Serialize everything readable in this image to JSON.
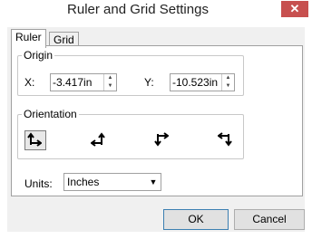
{
  "window": {
    "title": "Ruler and Grid Settings",
    "close_glyph": "✕"
  },
  "tabs": [
    {
      "label": "Ruler",
      "active": true
    },
    {
      "label": "Grid",
      "active": false
    }
  ],
  "origin": {
    "legend": "Origin",
    "x_label": "X:",
    "x_value": "-3.417in",
    "y_label": "Y:",
    "y_value": "-10.523in"
  },
  "orientation": {
    "legend": "Orientation",
    "options": [
      {
        "icon": "orientation-up-right-icon",
        "selected": true
      },
      {
        "icon": "orientation-up-left-icon",
        "selected": false
      },
      {
        "icon": "orientation-down-right-icon",
        "selected": false
      },
      {
        "icon": "orientation-down-left-icon",
        "selected": false
      }
    ]
  },
  "units": {
    "label": "Units:",
    "value": "Inches"
  },
  "buttons": {
    "ok": "OK",
    "cancel": "Cancel"
  },
  "colors": {
    "close_button": "#c7504f",
    "dialog_bg": "#f0f0f0",
    "default_button_border": "#3c7fb1"
  }
}
